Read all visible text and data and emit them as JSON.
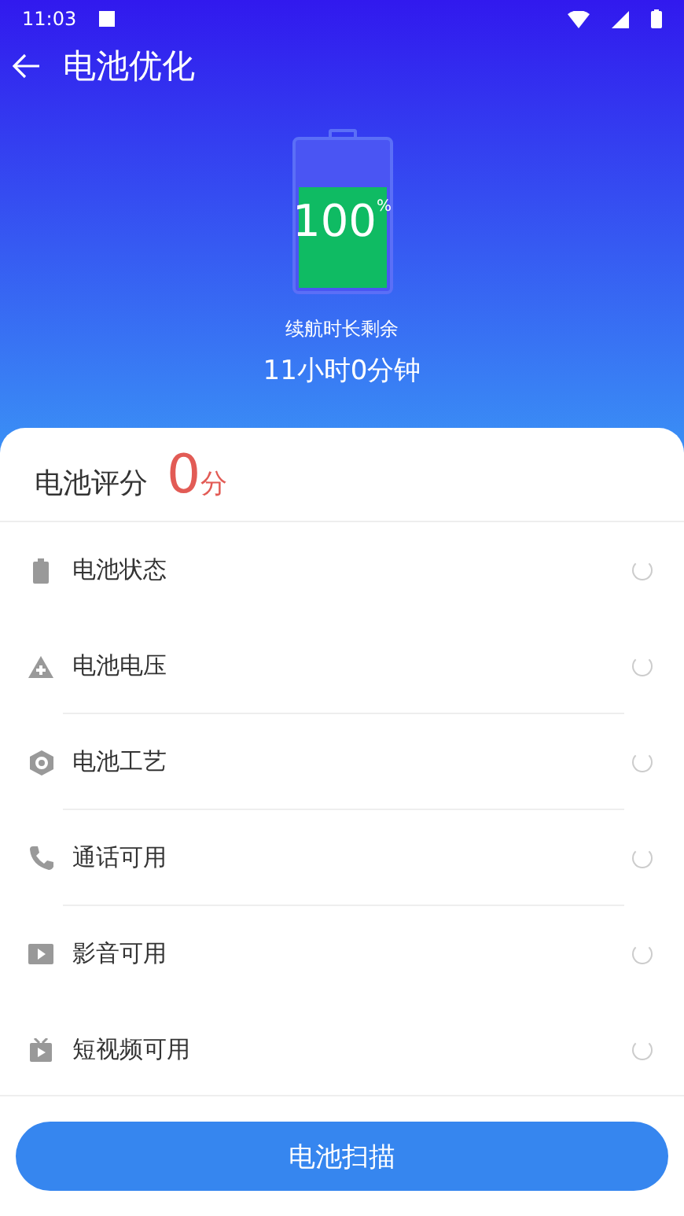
{
  "status_bar": {
    "time": "11:03"
  },
  "header": {
    "title": "电池优化"
  },
  "battery": {
    "percent": "100",
    "unit": "%",
    "caption": "续航时长剩余",
    "remaining": "11小时0分钟"
  },
  "score": {
    "label": "电池评分",
    "value": "0",
    "unit": "分"
  },
  "checks": [
    {
      "label": "电池状态",
      "divider": false
    },
    {
      "label": "电池电压",
      "divider": true
    },
    {
      "label": "电池工艺",
      "divider": true
    },
    {
      "label": "通话可用",
      "divider": true
    },
    {
      "label": "影音可用",
      "divider": false
    },
    {
      "label": "短视频可用",
      "divider": false
    }
  ],
  "button": {
    "label": "电池扫描"
  }
}
